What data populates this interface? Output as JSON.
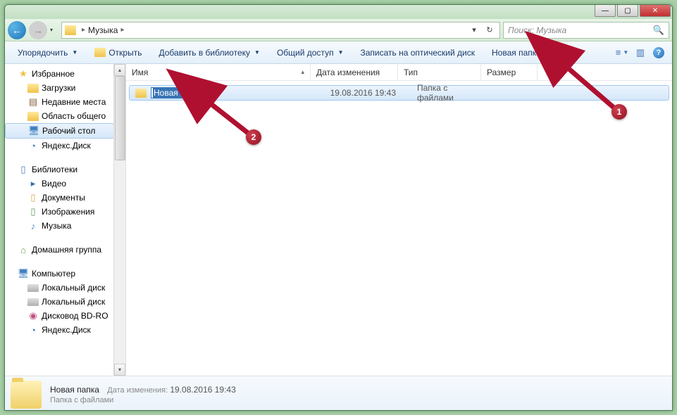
{
  "titlebar": {
    "min": "—",
    "max": "▢",
    "close": "✕"
  },
  "nav": {
    "back": "←",
    "fwd": "→",
    "drop": "▾"
  },
  "address": {
    "folder": "Музыка",
    "sep": "▸",
    "drop": "▾",
    "refresh": "↻"
  },
  "search": {
    "placeholder": "Поиск: Музыка",
    "icon": "🔍"
  },
  "toolbar": {
    "organize": "Упорядочить",
    "open": "Открыть",
    "addlib": "Добавить в библиотеку",
    "share": "Общий доступ",
    "burn": "Записать на оптический диск",
    "newfolder": "Новая папка",
    "view": "≡",
    "preview": "▥",
    "help": "?"
  },
  "sidebar": {
    "favorites": "Избранное",
    "downloads": "Загрузки",
    "recent": "Недавние места",
    "public": "Область общего",
    "desktop": "Рабочий стол",
    "yadisk": "Яндекс.Диск",
    "libraries": "Библиотеки",
    "videos": "Видео",
    "documents": "Документы",
    "pictures": "Изображения",
    "music": "Музыка",
    "homegroup": "Домашняя группа",
    "computer": "Компьютер",
    "localdisk1": "Локальный диск",
    "localdisk2": "Локальный диск",
    "bdrom": "Дисковод BD-RO",
    "yadisk2": "Яндекс.Диск"
  },
  "columns": {
    "name": "Имя",
    "modified": "Дата изменения",
    "type": "Тип",
    "size": "Размер"
  },
  "file": {
    "name": "Новая папка",
    "modified": "19.08.2016 19:43",
    "type": "Папка с файлами"
  },
  "details": {
    "name": "Новая папка",
    "type": "Папка с файлами",
    "modlabel": "Дата изменения:",
    "modval": "19.08.2016 19:43"
  },
  "annotations": {
    "n1": "1",
    "n2": "2"
  }
}
